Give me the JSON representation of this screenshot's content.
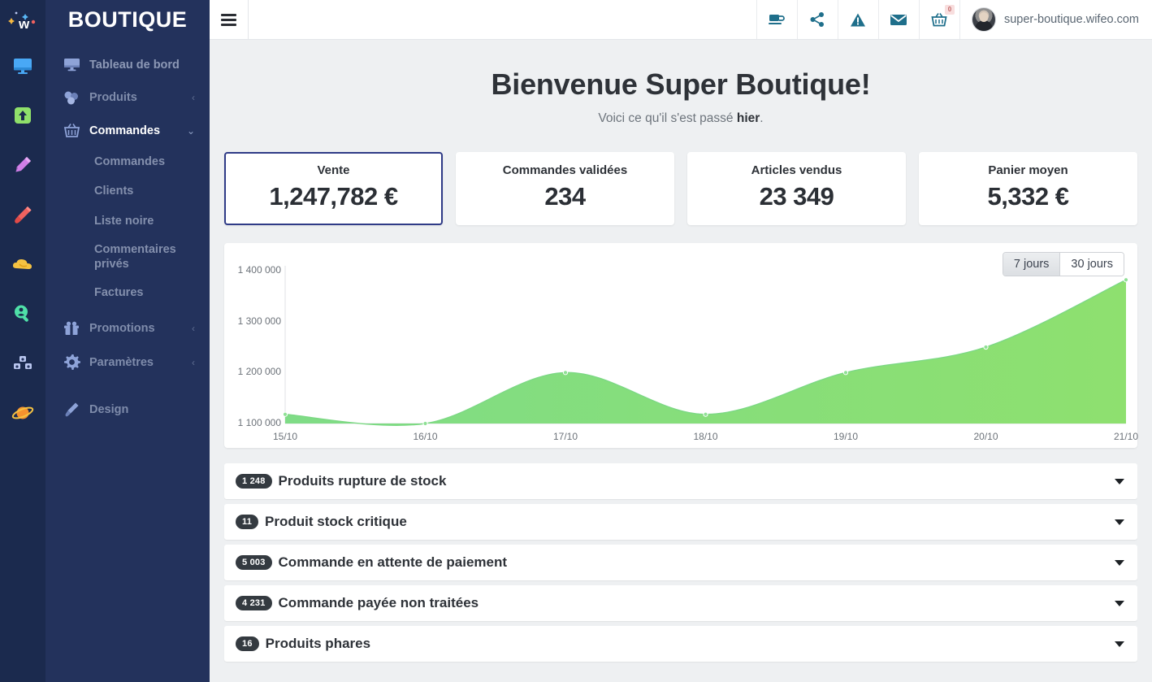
{
  "rail": {
    "logo": "wifeo-sparkle-logo",
    "icons": [
      {
        "name": "monitor-icon",
        "color": "#49a8f5"
      },
      {
        "name": "upload-arrow-icon",
        "color": "#8fe06a"
      },
      {
        "name": "pencil-icon",
        "color": "#d07fe8"
      },
      {
        "name": "paintbrush-icon",
        "color": "#f0625f"
      },
      {
        "name": "cloud-icon",
        "color": "#f5c242"
      },
      {
        "name": "search-user-icon",
        "color": "#4fe0a8"
      },
      {
        "name": "blocks-icon",
        "color": "#b9c6ef"
      },
      {
        "name": "planet-icon",
        "color": "#f5922e"
      }
    ]
  },
  "sidebar": {
    "brand": "BOUTIQUE",
    "items": [
      {
        "label": "Tableau de bord",
        "icon": "monitor-icon",
        "caret": "",
        "active": false
      },
      {
        "label": "Produits",
        "icon": "boxes-icon",
        "caret": "‹",
        "active": false
      },
      {
        "label": "Commandes",
        "icon": "basket-icon",
        "caret": "∨",
        "active": true
      },
      {
        "label": "Promotions",
        "icon": "gift-icon",
        "caret": "‹",
        "active": false
      },
      {
        "label": "Paramètres",
        "icon": "gear-icon",
        "caret": "‹",
        "active": false
      },
      {
        "label": "Design",
        "icon": "brush-icon",
        "caret": "",
        "active": false
      }
    ],
    "sub_items": [
      "Commandes",
      "Clients",
      "Liste noire",
      "Commentaires privés",
      "Factures"
    ]
  },
  "topbar": {
    "menu_icon": "hamburger-icon",
    "icons": [
      {
        "name": "coffee-icon"
      },
      {
        "name": "share-icon"
      },
      {
        "name": "warning-icon"
      },
      {
        "name": "envelope-icon"
      },
      {
        "name": "basket-icon",
        "badge": "0"
      }
    ],
    "user": "super-boutique.wifeo.com"
  },
  "welcome": {
    "title": "Bienvenue Super Boutique!",
    "subtitle_pre": "Voici ce qu'il s'est passé ",
    "subtitle_strong": "hier",
    "subtitle_post": "."
  },
  "stats": [
    {
      "label": "Vente",
      "value": "1,247,782 €",
      "selected": true
    },
    {
      "label": "Commandes validées",
      "value": "234",
      "selected": false
    },
    {
      "label": "Articles vendus",
      "value": "23 349",
      "selected": false
    },
    {
      "label": "Panier moyen",
      "value": "5,332 €",
      "selected": false
    }
  ],
  "range": {
    "options": [
      "7 jours",
      "30 jours"
    ],
    "selected": "7 jours"
  },
  "chart_data": {
    "type": "area",
    "title": "",
    "xlabel": "",
    "ylabel": "",
    "categories": [
      "15/10",
      "16/10",
      "17/10",
      "18/10",
      "19/10",
      "20/10",
      "21/10"
    ],
    "values": [
      1118000,
      1100000,
      1200000,
      1118000,
      1200000,
      1250000,
      1382000
    ],
    "ylim": [
      1100000,
      1400000
    ],
    "yticks": [
      1100000,
      1200000,
      1300000,
      1400000
    ],
    "ytick_labels": [
      "1 100 000",
      "1 200 000",
      "1 300 000",
      "1 400 000"
    ],
    "grid": false,
    "legend": "none",
    "series_color": "#72d37a",
    "fill_color": "#7fdc86",
    "point_color": "#8fe095"
  },
  "accordions": [
    {
      "badge": "1 248",
      "title": "Produits rupture de stock"
    },
    {
      "badge": "11",
      "title": "Produit stock critique"
    },
    {
      "badge": "5 003",
      "title": "Commande en attente de paiement"
    },
    {
      "badge": "4 231",
      "title": "Commande payée non traitées"
    },
    {
      "badge": "16",
      "title": "Produits phares"
    }
  ],
  "colors": {
    "accent": "#2f3b87",
    "sidebar": "#23325c",
    "rail": "#1b2a4e",
    "chart_green": "#7fdc86"
  }
}
